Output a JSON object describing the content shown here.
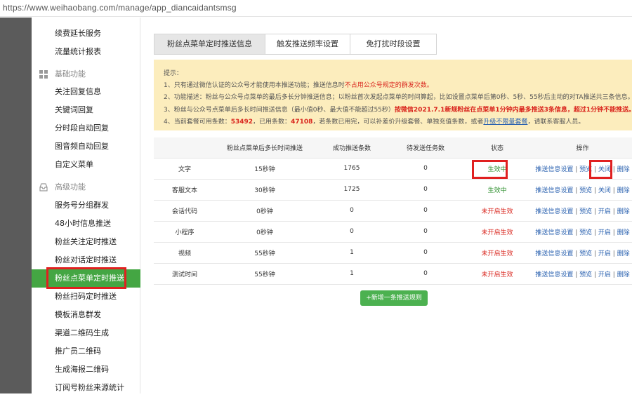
{
  "browser": {
    "url": "https://www.weihaobang.com/manage/app_diancaidantsmsg"
  },
  "sidebar": {
    "top_items": [
      "续费延长服务",
      "流量统计报表"
    ],
    "group_basic": "基础功能",
    "basic_items": [
      "关注回复信息",
      "关键词回复",
      "分时段自动回复",
      "图音频自动回复",
      "自定义菜单"
    ],
    "group_advanced": "高级功能",
    "advanced_items": [
      "服务号分组群发",
      "48小时信息推送",
      "粉丝关注定时推送",
      "粉丝对话定时推送",
      "粉丝点菜单定时推送",
      "粉丝扫码定时推送",
      "模板消息群发",
      "渠道二维码生成",
      "推广员二维码",
      "生成海报二维码",
      "订阅号粉丝来源统计"
    ],
    "active_item": "粉丝点菜单定时推送"
  },
  "tabs": [
    "粉丝点菜单定时推送信息",
    "触发推送频率设置",
    "免打扰时段设置"
  ],
  "notice": {
    "title": "提示：",
    "l1_a": "1、只有通过微信认证的公众号才能使用本推送功能；推送信息时",
    "l1_b": "不占用公众号规定的群发次数。",
    "l2": "2、功能描述：粉丝与公众号点菜单的最后多长分钟推送信息；以粉丝首次发起点菜单的时间算起，比如设置点菜单后第0秒、5秒、55秒后主动的对TA推送共三条信息。",
    "l3_a": "3、粉丝与公众号点菜单后多长时间推送信息（最小值0秒、最大值不能超过55秒）",
    "l3_b": "按微信2021.7.1新规粉丝在点菜单1分钟内最多推送3条信息，超过1分钟不能推送。",
    "l4_a": "4、当前套餐可用条数：",
    "l4_n1": "53492",
    "l4_b": "，已用条数：",
    "l4_n2": "47108",
    "l4_c": "，若条数已用完，可以补差价升级套餐、单独充值条数，或者",
    "l4_link": "升级不限量套餐",
    "l4_d": "，请联系客服人员。"
  },
  "table": {
    "headers": [
      "",
      "粉丝点菜单后多长时间推送",
      "成功推送条数",
      "待发送任务数",
      "状态",
      "操作"
    ],
    "rows": [
      {
        "type": "文字",
        "delay": "15秒钟",
        "success": "1765",
        "pending": "0",
        "status": "生效中",
        "status_on": true,
        "ops": [
          "推送信息设置",
          "预览",
          "关闭",
          "删除"
        ]
      },
      {
        "type": "客服文本",
        "delay": "30秒钟",
        "success": "1725",
        "pending": "0",
        "status": "生效中",
        "status_on": true,
        "ops": [
          "推送信息设置",
          "预览",
          "关闭",
          "删除"
        ]
      },
      {
        "type": "会话代码",
        "delay": "0秒钟",
        "success": "0",
        "pending": "0",
        "status": "未开启生效",
        "status_on": false,
        "ops": [
          "推送信息设置",
          "预览",
          "开启",
          "删除"
        ]
      },
      {
        "type": "小程序",
        "delay": "0秒钟",
        "success": "0",
        "pending": "0",
        "status": "未开启生效",
        "status_on": false,
        "ops": [
          "推送信息设置",
          "预览",
          "开启",
          "删除"
        ]
      },
      {
        "type": "视频",
        "delay": "55秒钟",
        "success": "1",
        "pending": "0",
        "status": "未开启生效",
        "status_on": false,
        "ops": [
          "推送信息设置",
          "预览",
          "开启",
          "删除"
        ]
      },
      {
        "type": "测试时间",
        "delay": "55秒钟",
        "success": "1",
        "pending": "0",
        "status": "未开启生效",
        "status_on": false,
        "ops": [
          "推送信息设置",
          "预览",
          "开启",
          "删除"
        ]
      }
    ]
  },
  "add_button": "+新增一条推送规则",
  "colors": {
    "accent": "#44a643",
    "highlight": "#e02020",
    "notice_bg": "#fcedbd",
    "link": "#2b62b0"
  }
}
